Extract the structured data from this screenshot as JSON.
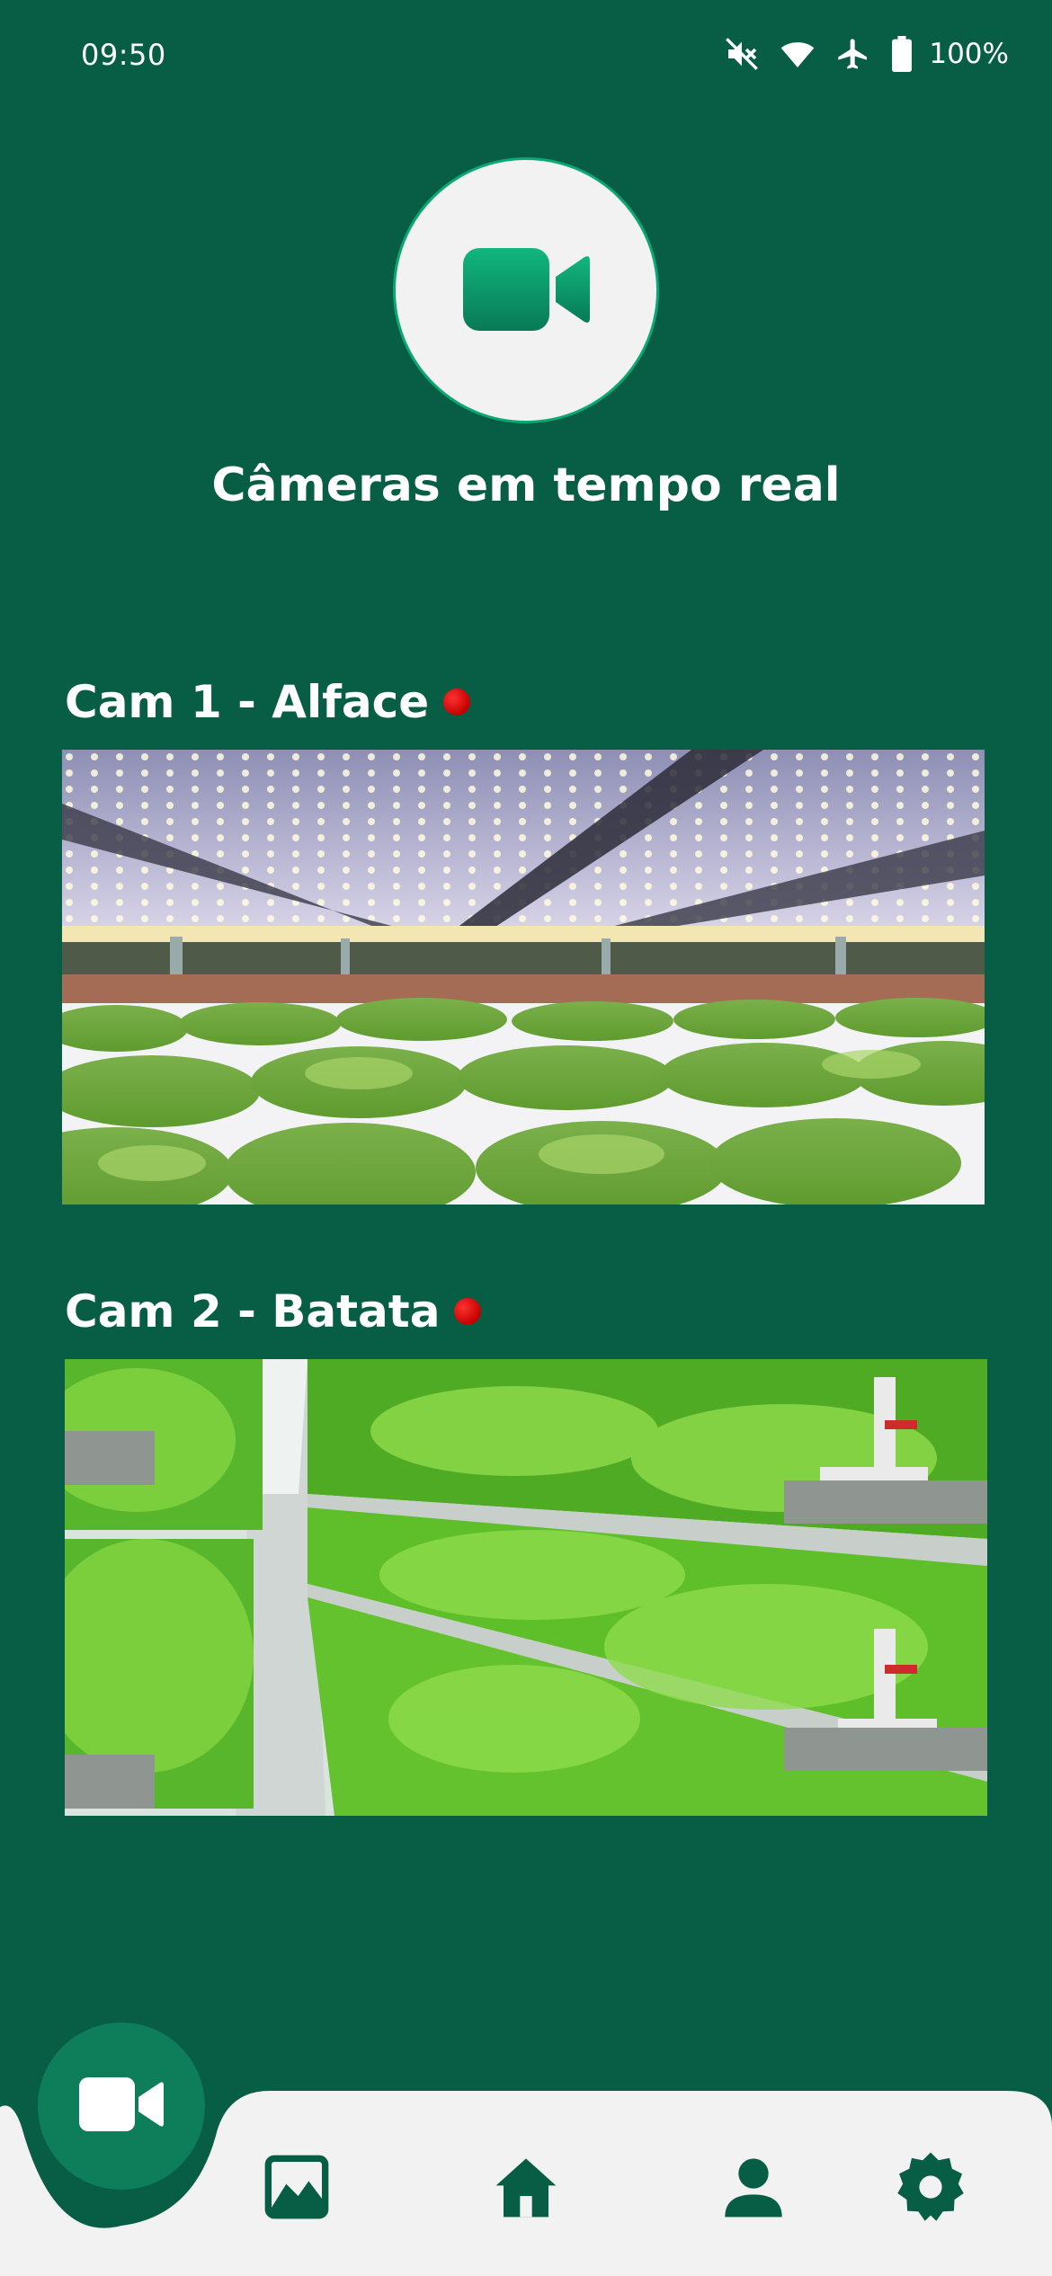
{
  "status_bar": {
    "time": "09:50",
    "battery_percent": "100%",
    "icons": [
      "mute-icon",
      "wifi-icon",
      "airplane-icon",
      "battery-icon"
    ]
  },
  "header": {
    "icon": "video-camera-icon",
    "title": "Câmeras em tempo real"
  },
  "cameras": [
    {
      "label": "Cam 1 - Alface",
      "live": true,
      "feed": "lettuce-hydroponic-farm"
    },
    {
      "label": "Cam 2 - Batata",
      "live": true,
      "feed": "vertical-farm-shelves"
    }
  ],
  "nav": {
    "active": "cameras",
    "items": [
      "video-camera-icon",
      "gallery-icon",
      "home-icon",
      "profile-icon",
      "settings-icon"
    ]
  },
  "colors": {
    "background": "#075e45",
    "accent": "#0aa872",
    "nav_bg": "#f2f2f2",
    "live_dot": "#d00000"
  }
}
